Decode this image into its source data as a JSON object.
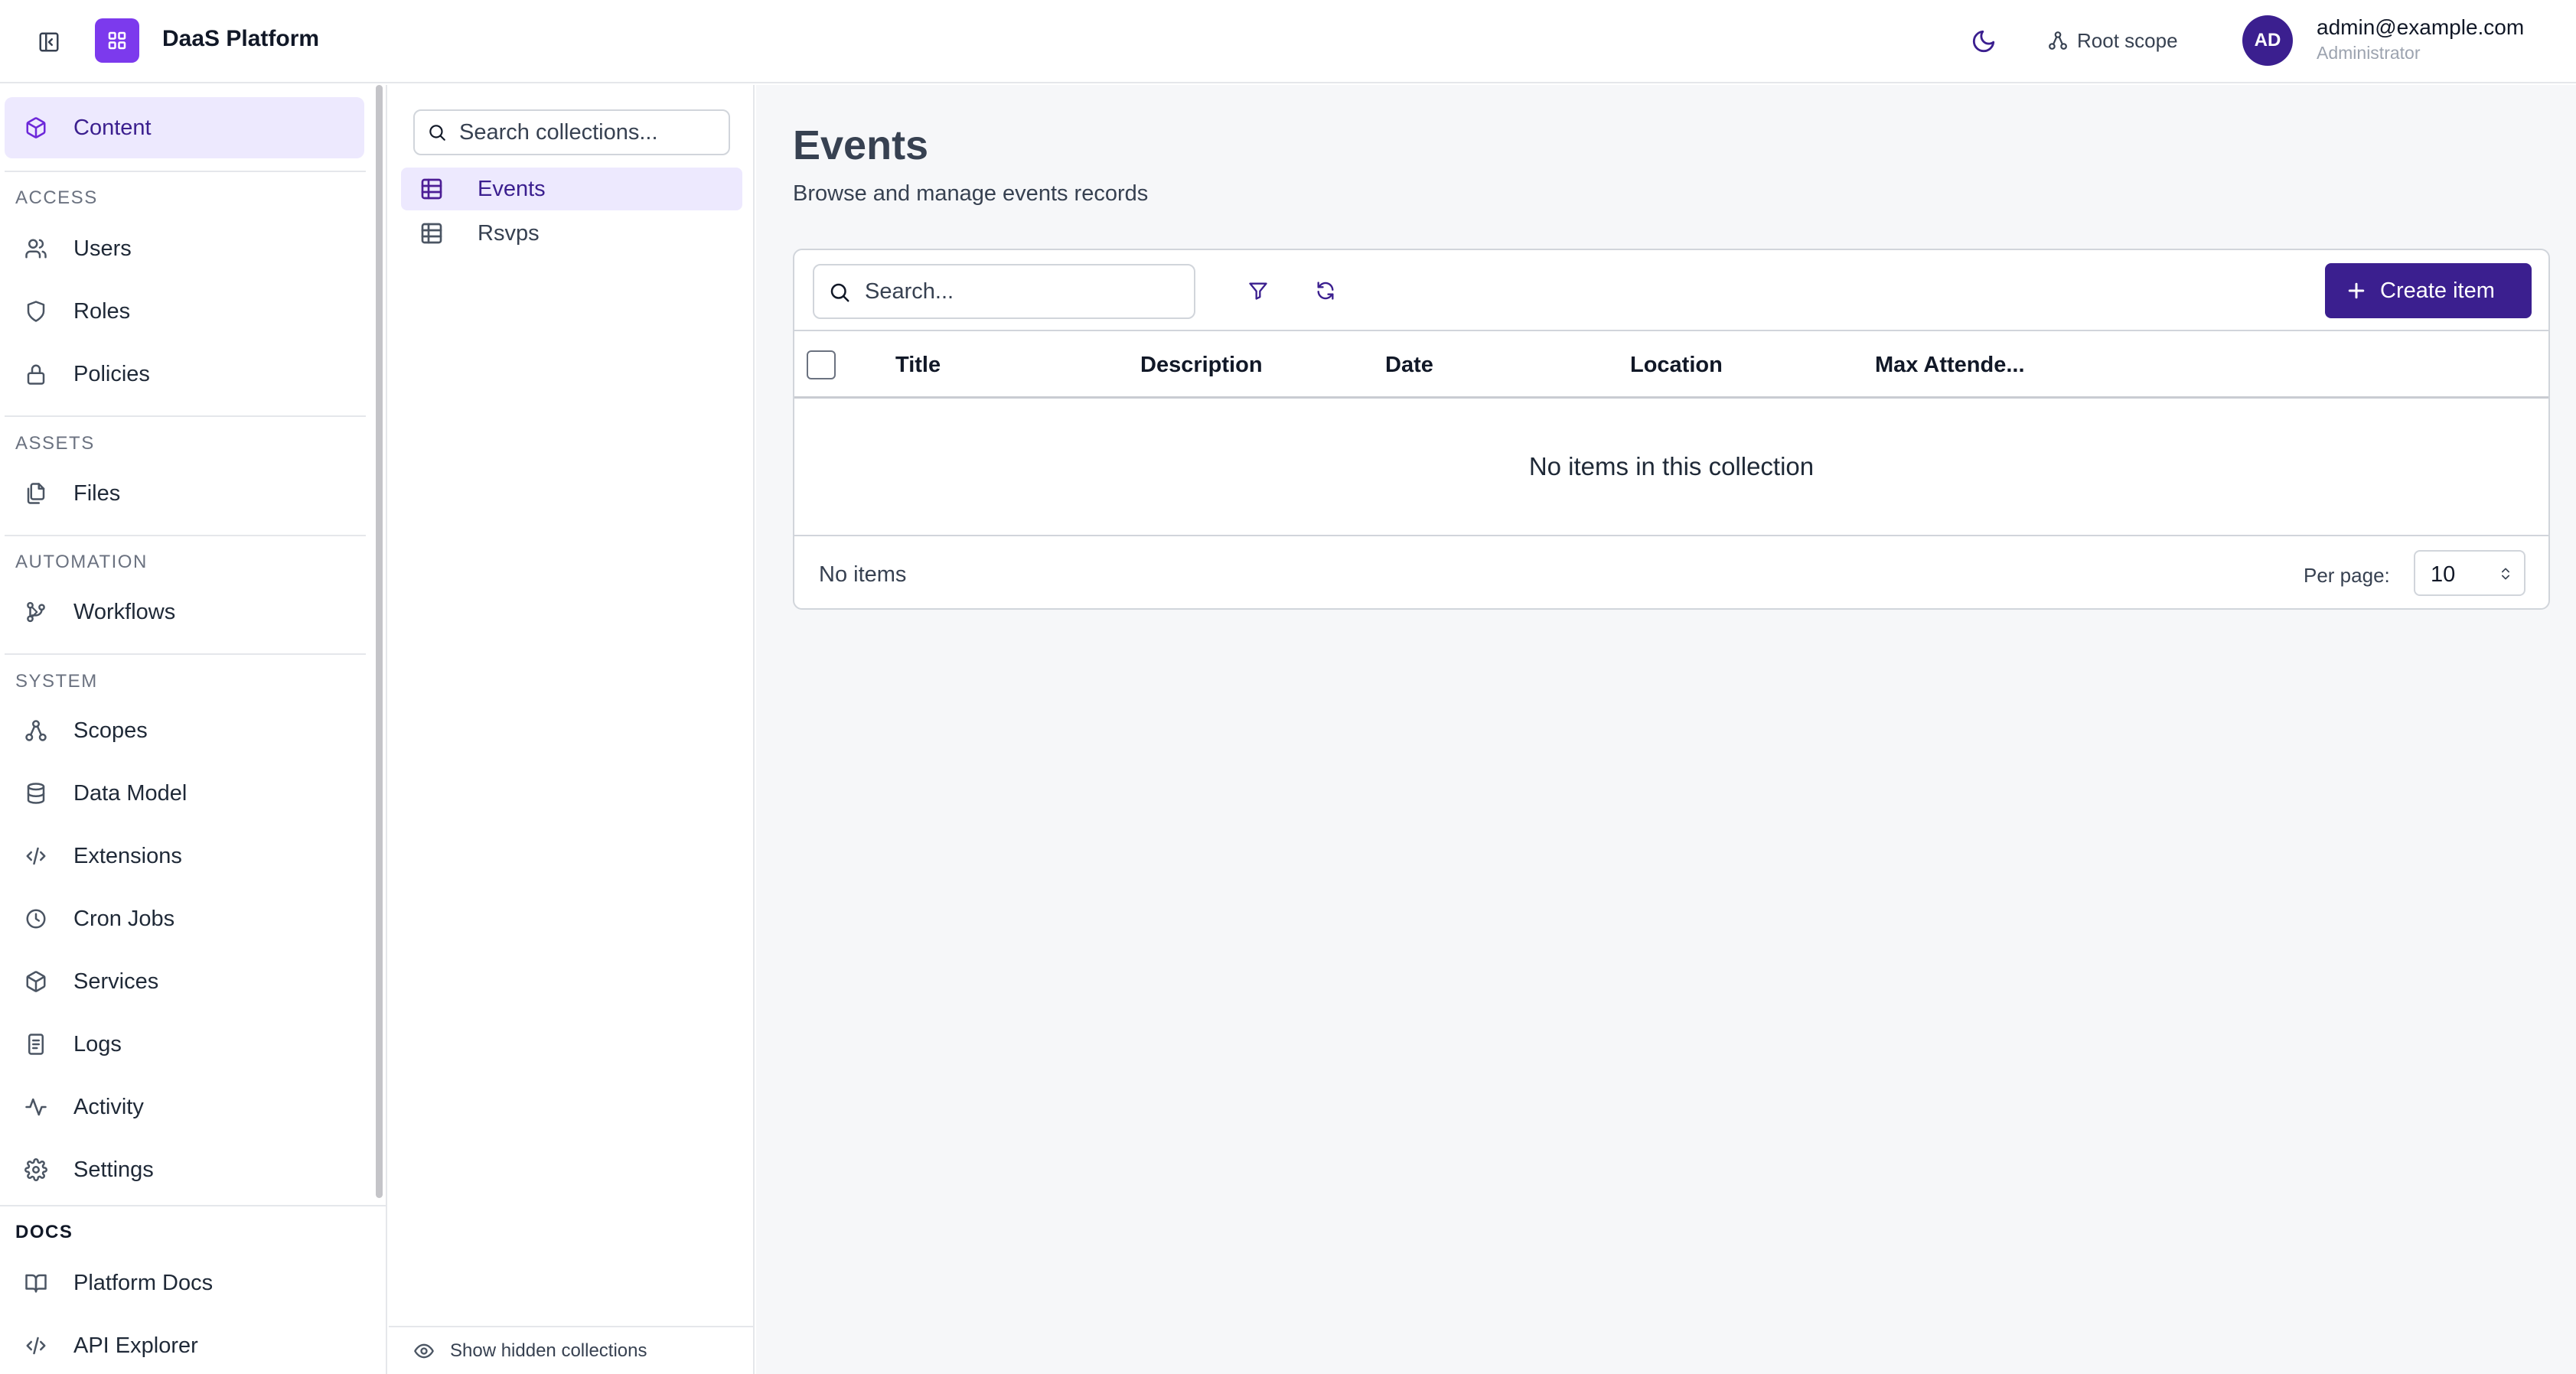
{
  "header": {
    "brand_name": "DaaS Platform",
    "scope_label": "Root scope",
    "user": {
      "initials": "AD",
      "email": "admin@example.com",
      "role": "Administrator"
    }
  },
  "sidebar": {
    "content_label": "Content",
    "sections": {
      "access": "ACCESS",
      "assets": "ASSETS",
      "automation": "AUTOMATION",
      "system": "SYSTEM",
      "docs": "DOCS"
    },
    "items": {
      "users": "Users",
      "roles": "Roles",
      "policies": "Policies",
      "files": "Files",
      "workflows": "Workflows",
      "scopes": "Scopes",
      "data_model": "Data Model",
      "extensions": "Extensions",
      "cron_jobs": "Cron Jobs",
      "services": "Services",
      "logs": "Logs",
      "activity": "Activity",
      "settings": "Settings",
      "platform_docs": "Platform Docs",
      "api_explorer": "API Explorer"
    }
  },
  "collections": {
    "search_placeholder": "Search collections...",
    "items": [
      "Events",
      "Rsvps"
    ],
    "footer_label": "Show hidden collections"
  },
  "main": {
    "title": "Events",
    "subtitle": "Browse and manage events records",
    "search_placeholder": "Search...",
    "create_label": "Create item",
    "columns": [
      "Title",
      "Description",
      "Date",
      "Location",
      "Max Attende..."
    ],
    "empty_message": "No items in this collection",
    "item_count": "No items",
    "per_page_label": "Per page:",
    "per_page_value": "10"
  },
  "colors": {
    "accent": "#3b1f8f",
    "brand": "#7c3aed",
    "active_bg": "#ede9fe"
  }
}
